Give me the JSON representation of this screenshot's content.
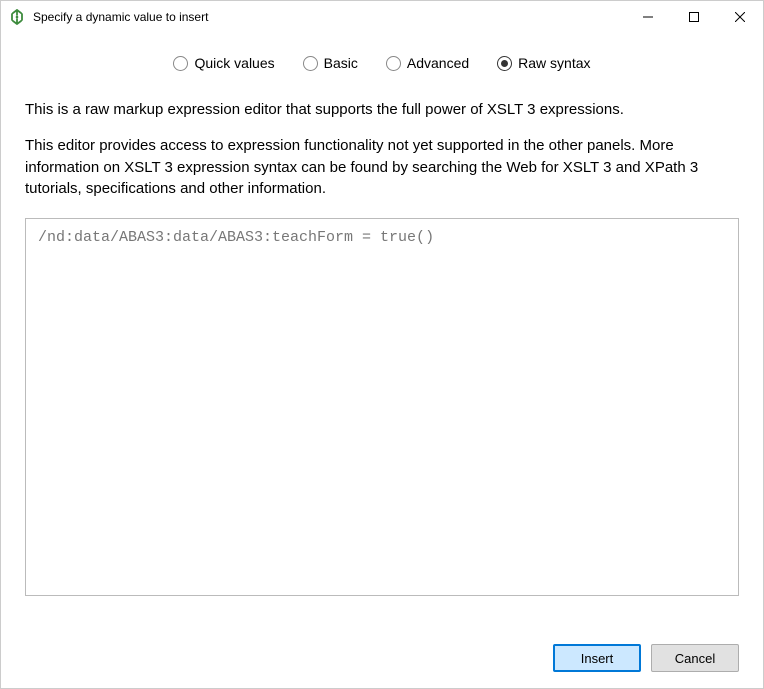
{
  "window": {
    "title": "Specify a dynamic value to insert"
  },
  "tabs": {
    "quick_values": "Quick values",
    "basic": "Basic",
    "advanced": "Advanced",
    "raw_syntax": "Raw syntax",
    "selected": "raw_syntax"
  },
  "description": {
    "line1": "This is a raw markup expression editor that supports the full power of XSLT 3 expressions.",
    "line2": "This editor provides access to expression functionality not yet supported in the other panels. More information on XSLT 3 expression syntax can be found by searching the Web for XSLT 3 and XPath 3 tutorials, specifications and other information."
  },
  "editor": {
    "value": "/nd:data/ABAS3:data/ABAS3:teachForm = true()"
  },
  "buttons": {
    "insert": "Insert",
    "cancel": "Cancel"
  }
}
